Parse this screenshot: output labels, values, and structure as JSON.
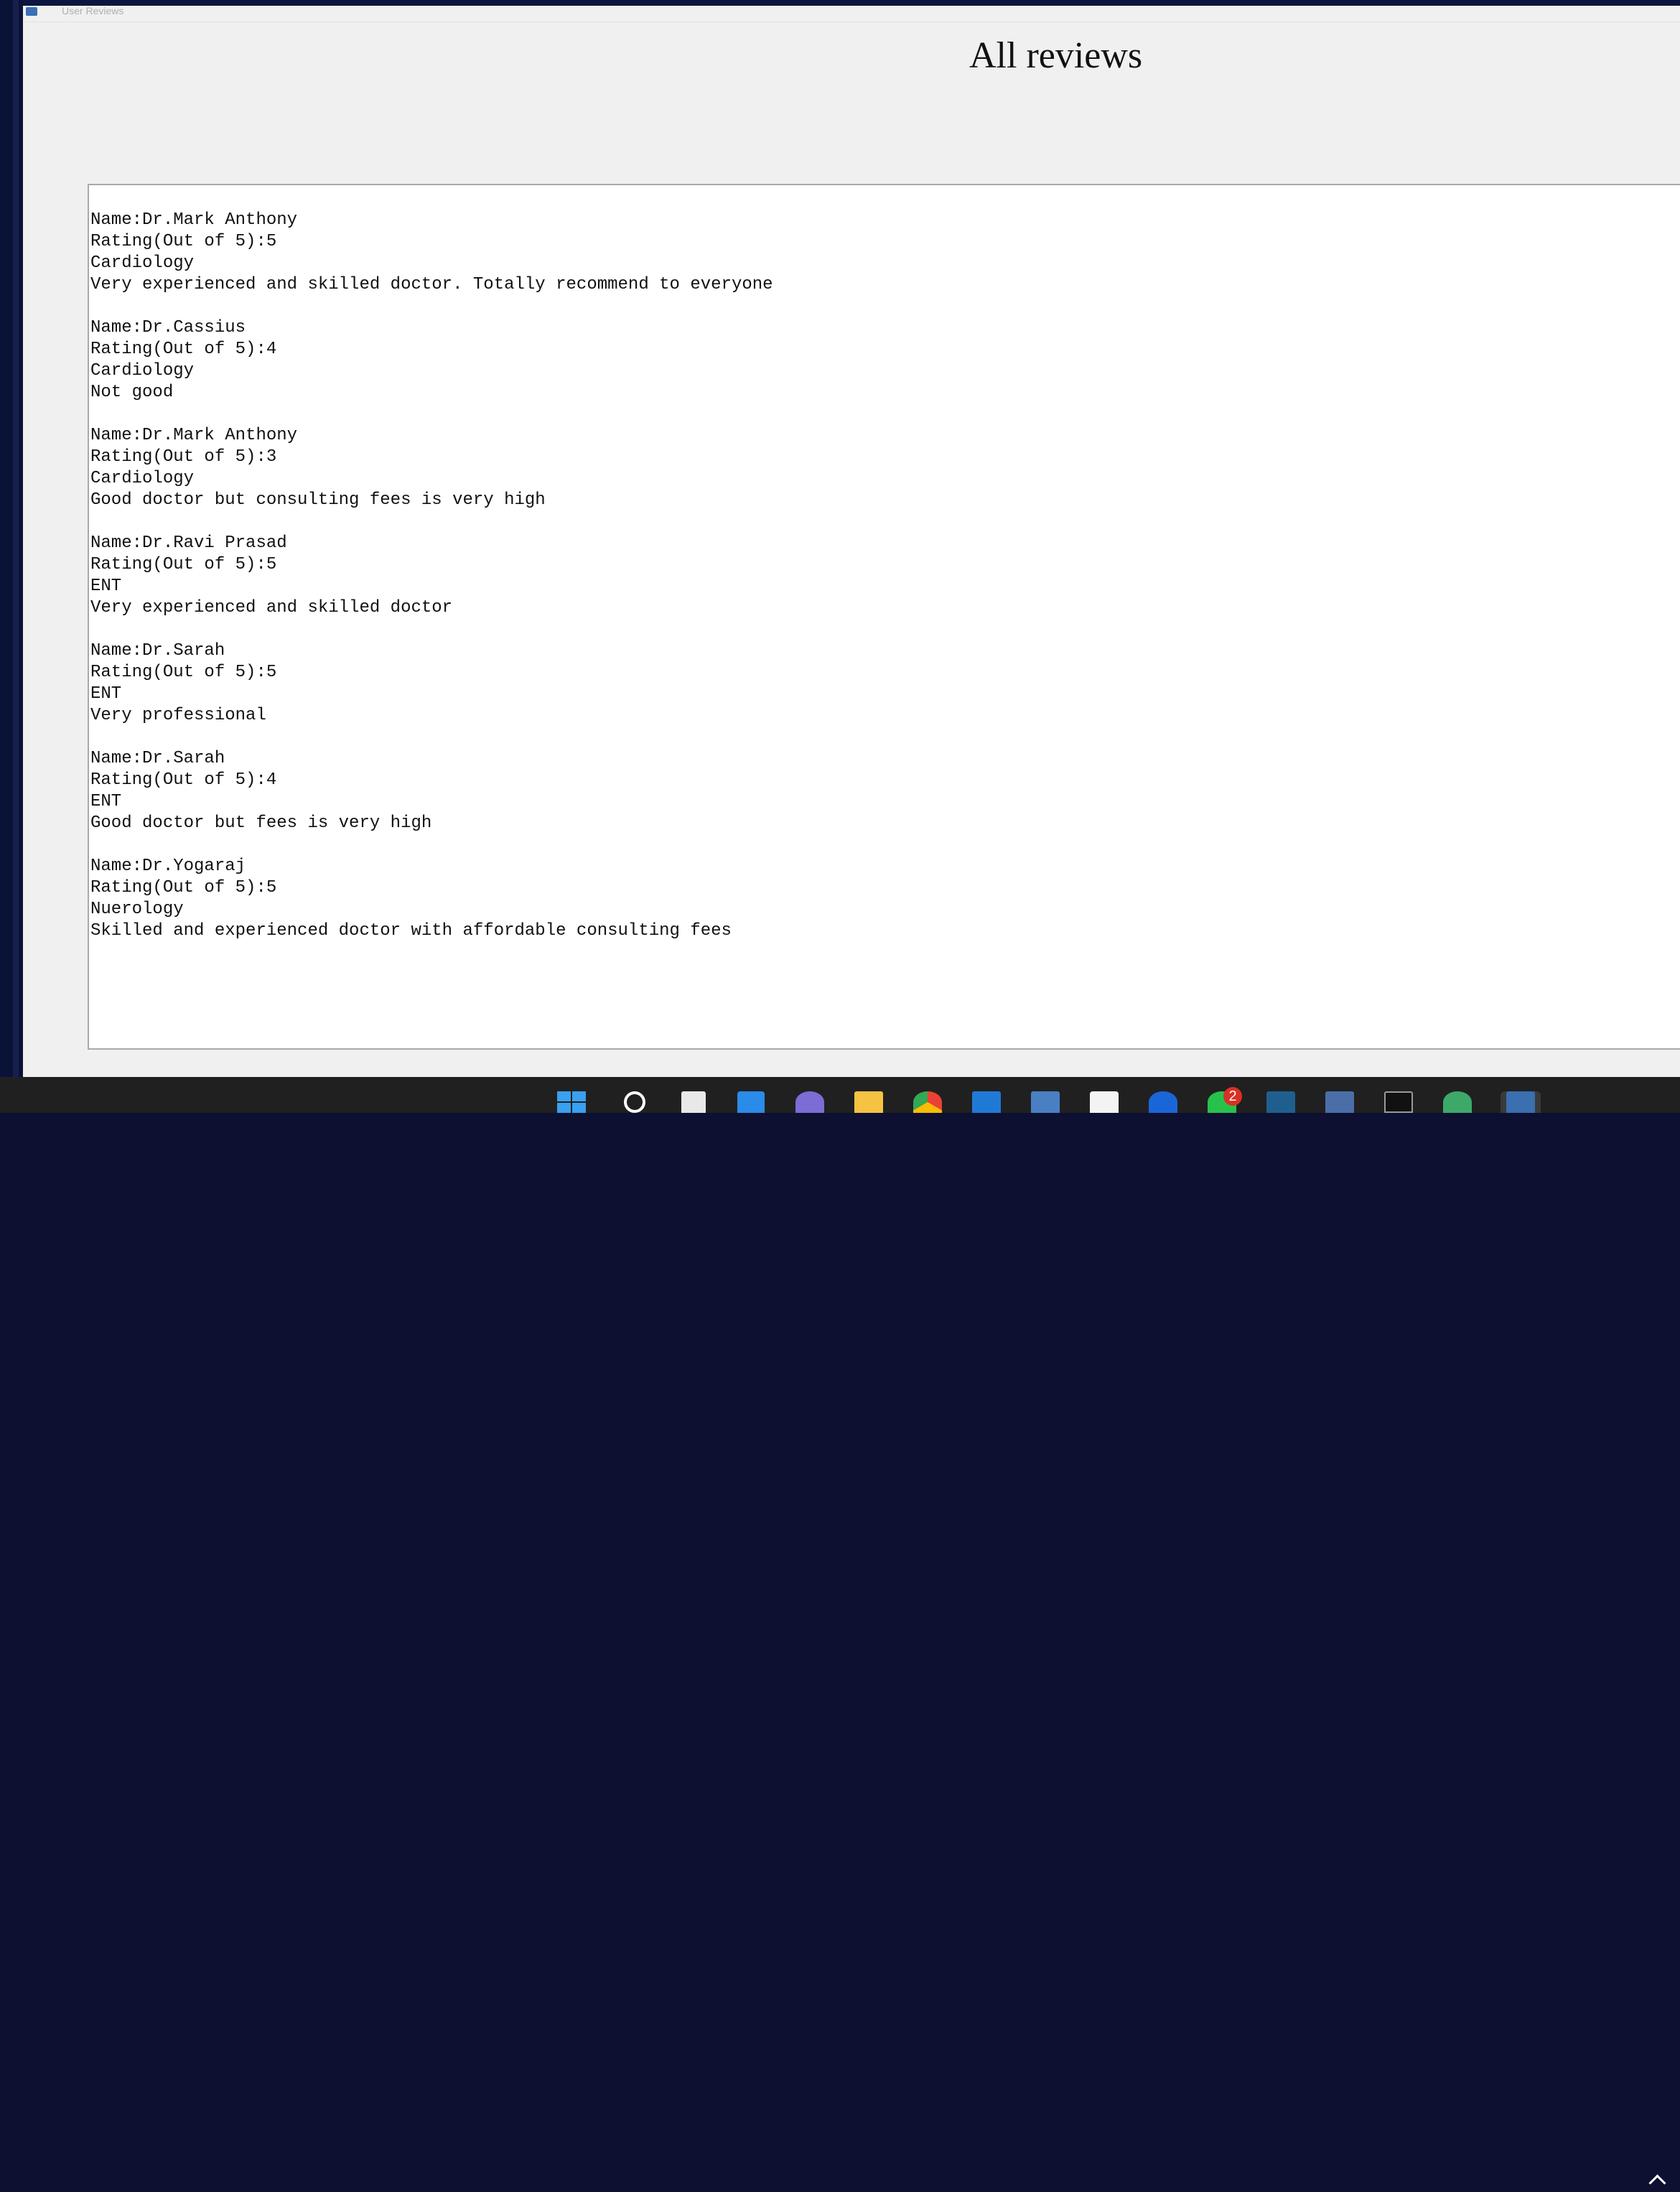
{
  "window": {
    "title": "User Reviews"
  },
  "page": {
    "title": "All reviews"
  },
  "reviews_text": "Name:Dr.Mark Anthony\nRating(Out of 5):5\nCardiology\nVery experienced and skilled doctor. Totally recommend to everyone\n\nName:Dr.Cassius\nRating(Out of 5):4\nCardiology\nNot good\n\nName:Dr.Mark Anthony\nRating(Out of 5):3\nCardiology\nGood doctor but consulting fees is very high\n\nName:Dr.Ravi Prasad\nRating(Out of 5):5\nENT\nVery experienced and skilled doctor\n\nName:Dr.Sarah\nRating(Out of 5):5\nENT\nVery professional\n\nName:Dr.Sarah\nRating(Out of 5):4\nENT\nGood doctor but fees is very high\n\nName:Dr.Yogaraj\nRating(Out of 5):5\nNuerology\nSkilled and experienced doctor with affordable consulting fees",
  "taskbar": {
    "items": [
      {
        "name": "start-icon"
      },
      {
        "name": "search-icon"
      },
      {
        "name": "task-view-icon"
      },
      {
        "name": "widgets-icon"
      },
      {
        "name": "teams-icon"
      },
      {
        "name": "file-explorer-icon"
      },
      {
        "name": "chrome-icon"
      },
      {
        "name": "mail-icon"
      },
      {
        "name": "app-icon"
      },
      {
        "name": "store-icon"
      },
      {
        "name": "bing-icon"
      },
      {
        "name": "whatsapp-icon"
      },
      {
        "name": "mysql-icon"
      },
      {
        "name": "app-icon"
      },
      {
        "name": "terminal-icon"
      },
      {
        "name": "atom-icon"
      },
      {
        "name": "python-icon"
      }
    ],
    "whatsapp_badge": "2"
  }
}
